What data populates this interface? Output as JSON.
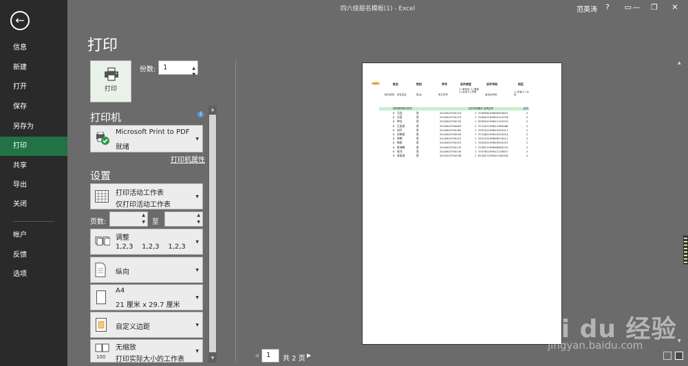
{
  "window": {
    "title": "四六级报名模板(1) - Excel",
    "user": "范英涛",
    "help": "?",
    "minimize": "—",
    "restore": "❐",
    "close": "✕"
  },
  "sidebar": {
    "back_icon": "←",
    "items": [
      {
        "label": "信息"
      },
      {
        "label": "新建"
      },
      {
        "label": "打开"
      },
      {
        "label": "保存"
      },
      {
        "label": "另存为"
      },
      {
        "label": "打印"
      },
      {
        "label": "共享"
      },
      {
        "label": "导出"
      },
      {
        "label": "关闭"
      },
      {
        "label": "帐户"
      },
      {
        "label": "反馈"
      },
      {
        "label": "选项"
      }
    ]
  },
  "print": {
    "heading": "打印",
    "button_label": "打印",
    "copies_label": "份数:",
    "copies_value": "1"
  },
  "printer": {
    "heading": "打印机",
    "info": "i",
    "name": "Microsoft Print to PDF",
    "status": "就绪",
    "properties_link": "打印机属性"
  },
  "settings": {
    "heading": "设置",
    "scope": {
      "line1": "打印活动工作表",
      "line2": "仅打印活动工作表"
    },
    "pages_label": "页数:",
    "to_label": "至",
    "collate": {
      "line1": "调整",
      "line2": "1,2,3    1,2,3    1,2,3"
    },
    "orientation": {
      "line1": "纵向"
    },
    "paper": {
      "line1": "A4",
      "line2": "21 厘米 x 29.7 厘米"
    },
    "margins": {
      "line1": "自定义边距"
    },
    "scaling": {
      "line1": "无缩放",
      "line2": "打印实际大小的工作表"
    }
  },
  "preview": {
    "headers": [
      "姓名",
      "性别",
      "学号",
      "证件类型",
      "证件号码",
      "校区"
    ],
    "desc": [
      "填写说明",
      "考生姓名",
      "男/女",
      "考生学号",
      "1=身份证 2=港澳 3=台湾 4=护照",
      "身份证号码",
      "1=本部 2=分校"
    ],
    "band_left": "请勿修改表头样式",
    "band_right": "证件号码格式  准考证号",
    "band_mid": "级别",
    "rows": [
      [
        "6",
        "马浩",
        "男",
        "2014610700119",
        "1",
        "370828199608302832",
        "2"
      ],
      [
        "6",
        "吕莹",
        "男",
        "2014610700122",
        "1",
        "310822199902112218",
        "2"
      ],
      [
        "6",
        "李佳",
        "男",
        "2014610700132",
        "1",
        "632824199811124010",
        "2"
      ],
      [
        "6",
        "王英贤",
        "男",
        "2014610700087",
        "1",
        "371322199611069288",
        "2"
      ],
      [
        "6",
        "刘丹",
        "男",
        "2014610700182",
        "1",
        "370322199812091017",
        "2"
      ],
      [
        "6",
        "孙晓雨",
        "男",
        "2014610700094",
        "1",
        "371482199510252014",
        "2"
      ],
      [
        "6",
        "李朝",
        "男",
        "2014610700121",
        "1",
        "520123199606233411",
        "2"
      ],
      [
        "6",
        "杨振",
        "男",
        "2014610700191",
        "1",
        "310922199609242031",
        "2"
      ],
      [
        "6",
        "陈海峰",
        "男",
        "2014610700170",
        "1",
        "370811199608282210",
        "2"
      ],
      [
        "6",
        "张洋",
        "男",
        "2014610700145",
        "1",
        "370782199511133871",
        "2"
      ],
      [
        "6",
        "张英涛",
        "男",
        "2013410700208",
        "1",
        "622827199501180326",
        "2"
      ]
    ]
  },
  "pager": {
    "prev": "◀",
    "current": "1",
    "total": "共 2 页",
    "next": "▶"
  },
  "watermark": {
    "main": "Bai du 经验",
    "url": "jingyan.baidu.com"
  },
  "colors": {
    "sidebar_bg": "#2a2a2a",
    "active": "#217346",
    "backstage_bg": "#6b6b6b"
  }
}
